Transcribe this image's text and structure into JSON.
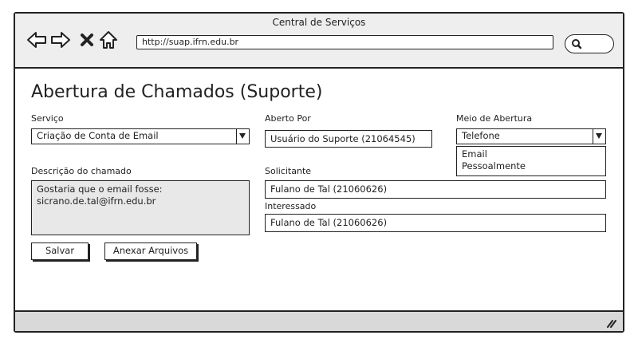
{
  "window": {
    "title": "Central de Serviços"
  },
  "browser": {
    "url": "http://suap.ifrn.edu.br"
  },
  "page": {
    "heading": "Abertura de Chamados (Suporte)"
  },
  "form": {
    "servico": {
      "label": "Serviço",
      "value": "Criação de Conta de Email"
    },
    "aberto_por": {
      "label": "Aberto Por",
      "value": "Usuário do Suporte (21064545)"
    },
    "meio_abertura": {
      "label": "Meio de Abertura",
      "value": "Telefone",
      "options": [
        "Email",
        "Pessoalmente"
      ]
    },
    "descricao": {
      "label": "Descrição do chamado",
      "lines": [
        "Gostaria que o email fosse:",
        "sicrano.de.tal@ifrn.edu.br"
      ]
    },
    "solicitante": {
      "label": "Solicitante",
      "value": "Fulano de Tal (21060626)"
    },
    "interessado": {
      "label": "Interessado",
      "value": "Fulano de Tal (21060626)"
    }
  },
  "buttons": {
    "save": "Salvar",
    "attach": "Anexar Arquivos"
  },
  "icons": [
    "back-arrow-icon",
    "forward-arrow-icon",
    "close-icon",
    "home-icon",
    "search-icon",
    "resize-grip-icon"
  ]
}
